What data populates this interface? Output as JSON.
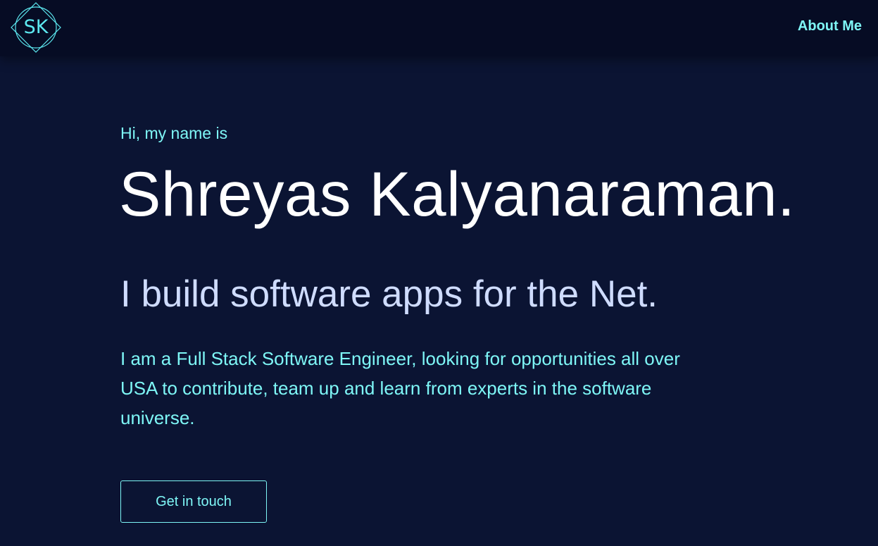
{
  "header": {
    "logo_text": "SK",
    "nav_about_label": "About Me"
  },
  "hero": {
    "greeting": "Hi, my name is",
    "name": "Shreyas Kalyanaraman.",
    "tagline": "I build software apps for the Net.",
    "bio": "I am a Full Stack Software Engineer, looking for opportunities all over USA to contribute, team up and learn from experts in the software universe.",
    "cta_label": "Get in touch"
  },
  "colors": {
    "background": "#0b1433",
    "nav_background": "#060c24",
    "accent": "#7ef6f6",
    "name_text": "#ffffff",
    "tagline_text": "#cfdcff"
  }
}
